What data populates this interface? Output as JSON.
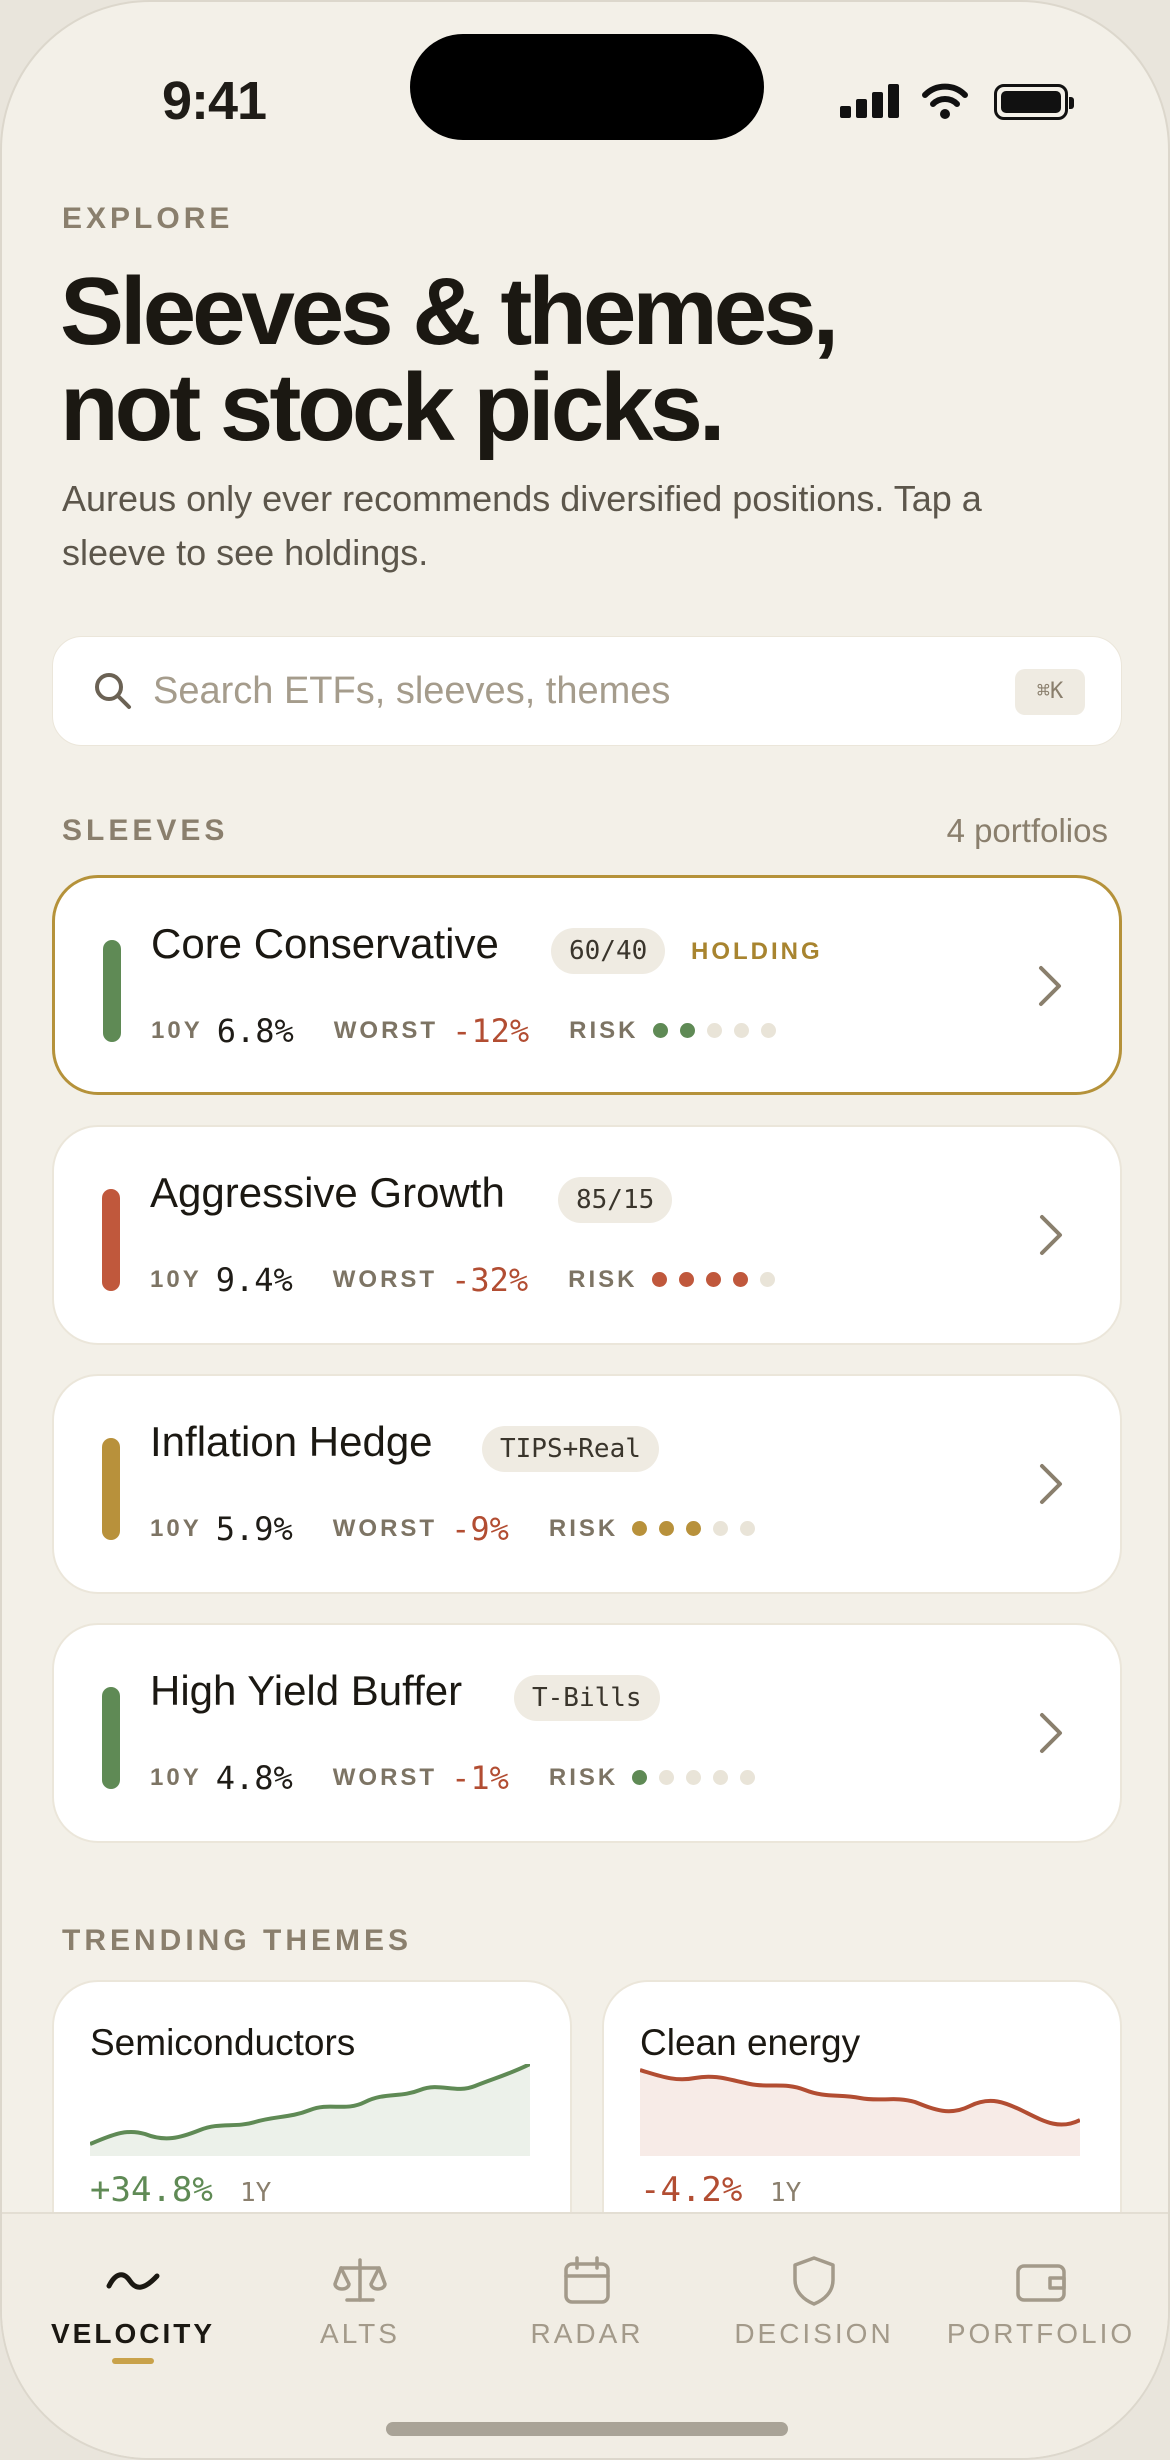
{
  "status": {
    "time": "9:41"
  },
  "header": {
    "eyebrow": "EXPLORE",
    "title_line1": "Sleeves & themes,",
    "title_line2": "not stock picks.",
    "subtitle": "Aureus only ever recommends diversified positions. Tap a sleeve to see holdings."
  },
  "search": {
    "placeholder": "Search ETFs, sleeves, themes",
    "value": "",
    "shortcut": "⌘K"
  },
  "sleeves": {
    "label": "SLEEVES",
    "count": "4 portfolios",
    "stat_labels": {
      "return": "10Y",
      "worst": "WORST",
      "risk": "RISK"
    },
    "items": [
      {
        "name": "Core Conservative",
        "tag": "60/40",
        "holding": "HOLDING",
        "return": "6.8%",
        "worst": "-12%",
        "risk": 2,
        "color": "#5f8a55"
      },
      {
        "name": "Aggressive Growth",
        "tag": "85/15",
        "holding": "",
        "return": "9.4%",
        "worst": "-32%",
        "risk": 4,
        "color": "#c0583c"
      },
      {
        "name": "Inflation Hedge",
        "tag": "TIPS+Real",
        "holding": "",
        "return": "5.9%",
        "worst": "-9%",
        "risk": 3,
        "color": "#b8913b"
      },
      {
        "name": "High Yield Buffer",
        "tag": "T-Bills",
        "holding": "",
        "return": "4.8%",
        "worst": "-1%",
        "risk": 1,
        "color": "#5f8a55"
      }
    ]
  },
  "themes": {
    "label": "TRENDING THEMES",
    "items": [
      {
        "name": "Semiconductors",
        "change": "+34.8%",
        "period": "1Y",
        "color": "#5f8a55"
      },
      {
        "name": "Clean energy",
        "change": "-4.2%",
        "period": "1Y",
        "color": "#b24d32"
      }
    ]
  },
  "tabs": [
    {
      "label": "VELOCITY",
      "icon": "velocity-wave-icon",
      "active": true
    },
    {
      "label": "ALTS",
      "icon": "scale-icon",
      "active": false
    },
    {
      "label": "RADAR",
      "icon": "calendar-icon",
      "active": false
    },
    {
      "label": "DECISION",
      "icon": "shield-icon",
      "active": false
    },
    {
      "label": "PORTFOLIO",
      "icon": "wallet-icon",
      "active": false
    }
  ]
}
